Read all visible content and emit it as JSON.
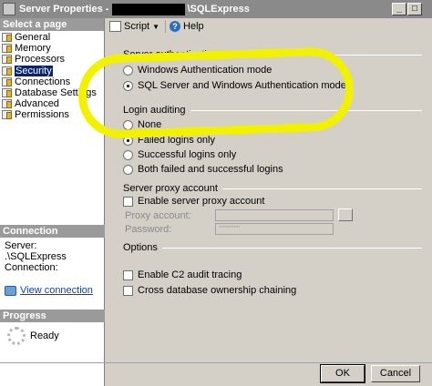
{
  "window": {
    "title_prefix": "Server Properties - ",
    "title_suffix": "\\SQLExpress",
    "minimize_label": "_",
    "maximize_label": "□"
  },
  "left": {
    "select_header": "Select a page",
    "pages": [
      {
        "label": "General",
        "selected": false
      },
      {
        "label": "Memory",
        "selected": false
      },
      {
        "label": "Processors",
        "selected": false
      },
      {
        "label": "Security",
        "selected": true
      },
      {
        "label": "Connections",
        "selected": false
      },
      {
        "label": "Database Settings",
        "selected": false
      },
      {
        "label": "Advanced",
        "selected": false
      },
      {
        "label": "Permissions",
        "selected": false
      }
    ],
    "connection_header": "Connection",
    "server_label": "Server:",
    "server_value": ".\\SQLExpress",
    "connection_label": "Connection:",
    "view_connection": "View connection",
    "progress_header": "Progress",
    "progress_status": "Ready"
  },
  "toolbar": {
    "script_label": "Script",
    "help_label": "Help",
    "help_glyph": "?"
  },
  "security": {
    "server_auth_header": "Server authentication",
    "windows_auth": "Windows Authentication mode",
    "mixed_auth": "SQL Server and Windows Authentication mode",
    "selected_auth": "SQL Server and Windows Authentication mode",
    "login_auditing_header": "Login auditing",
    "audit_none": "None",
    "audit_failed": "Failed logins only",
    "audit_success": "Successful logins only",
    "audit_both": "Both failed and successful logins",
    "selected_audit": "Failed logins only",
    "proxy_header": "Server proxy account",
    "enable_proxy": "Enable server proxy account",
    "proxy_account_label": "Proxy account:",
    "password_label": "Password:",
    "password_mask": "**********",
    "options_header": "Options",
    "c2_audit": "Enable C2 audit tracing",
    "cross_db": "Cross database ownership chaining"
  },
  "buttons": {
    "ok": "OK",
    "cancel": "Cancel"
  },
  "colors": {
    "highlight": "#f2f200",
    "selected_item": "#0a246a",
    "link": "#1040b0"
  },
  "icons": {
    "page": "page-icon",
    "view_connection": "connection-properties-icon",
    "script": "script-icon",
    "help": "help-icon",
    "progress": "spinner-icon"
  }
}
